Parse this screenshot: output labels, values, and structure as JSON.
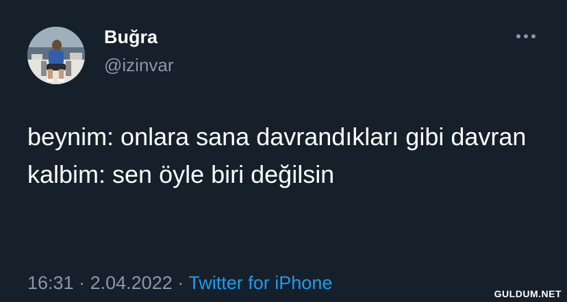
{
  "author": {
    "display_name": "Buğra",
    "handle": "@izinvar",
    "avatar_icon": "user-photo"
  },
  "more_icon": "more-horizontal-icon",
  "tweet": {
    "text": "beynim: onlara sana davrandıkları gibi davran\nkalbim: sen öyle biri değilsin",
    "time": "16:31",
    "separator_1": "·",
    "date": "2.04.2022",
    "separator_2": "·",
    "source": "Twitter for iPhone"
  },
  "watermark": "GULDUM.NET",
  "colors": {
    "background": "#15202b",
    "text": "#ffffff",
    "secondary": "#8b98a5",
    "accent": "#1d9bf0"
  }
}
